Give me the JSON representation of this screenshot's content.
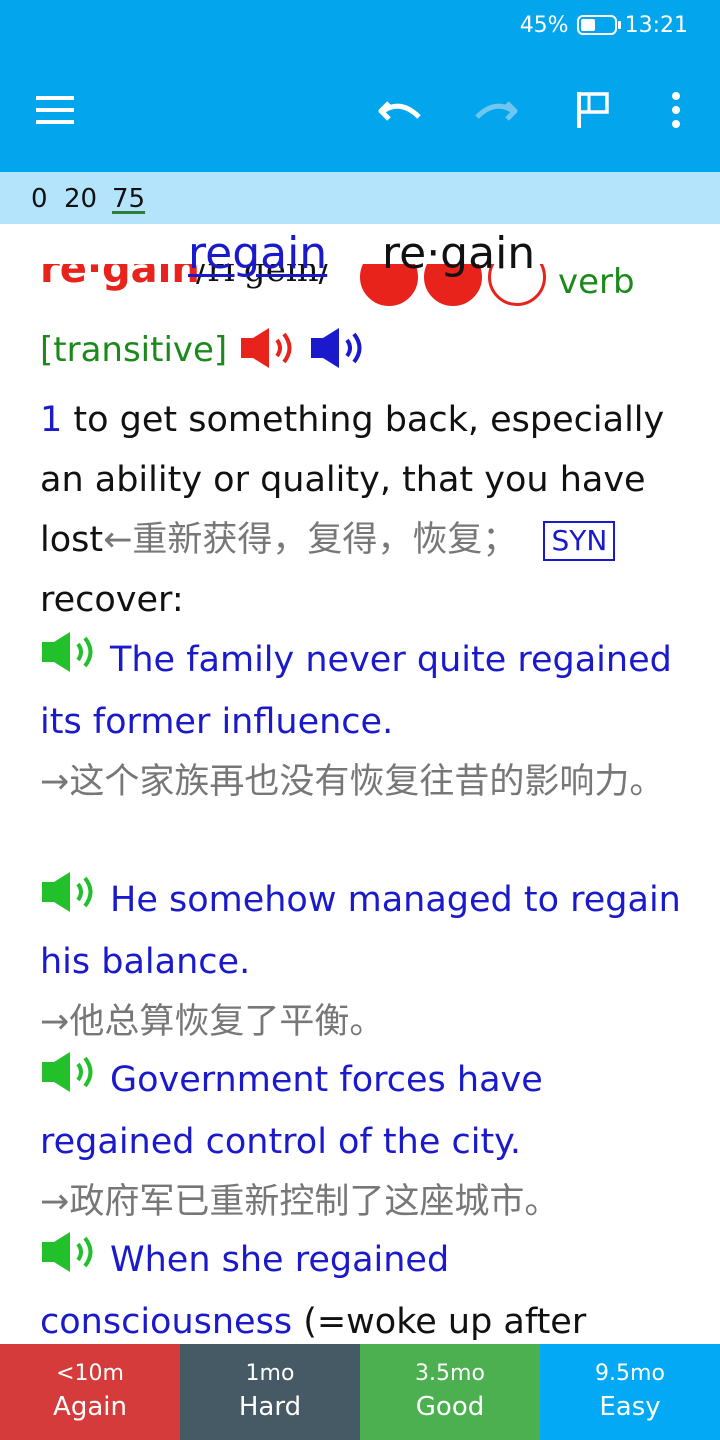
{
  "status_bar": {
    "battery": "45%",
    "time": "13:21",
    "battery_level": 0.45
  },
  "toolbar": {
    "icons": [
      "menu-icon",
      "undo-icon",
      "redo-icon",
      "flag-icon",
      "more-vert-icon"
    ]
  },
  "counts": {
    "new": "0",
    "learning": "20",
    "review": "75"
  },
  "question": {
    "word": "regain",
    "headword": "re·gain"
  },
  "entry": {
    "headword": "re·gain",
    "phonetic": "/rɪˈɡeɪn/",
    "frequency_dots_filled": 2,
    "frequency_dots_total": 3,
    "pos": "verb",
    "grammar": "[transitive]"
  },
  "definition": {
    "number": "1",
    "text": "to get something back, especially an ability or quality, that you have lost",
    "zh": "←重新获得，复得，恢复；",
    "syn_label": "SYN",
    "syn_word": " recover:"
  },
  "examples": [
    {
      "en": "The family never quite regained its former influence.",
      "zh": "→这个家族再也没有恢复往昔的影响力。"
    },
    {
      "en": "He somehow managed to regain his balance.",
      "zh": "→他总算恢复了平衡。"
    },
    {
      "en": "Government forces have regained control of the city.",
      "zh": "→政府军已重新控制了这座城市。"
    },
    {
      "en": "When she regained consciousness",
      "extra": " (=woke up after",
      "zh": ""
    }
  ],
  "answers": [
    {
      "interval": "<10m",
      "label": "Again"
    },
    {
      "interval": "1mo",
      "label": "Hard"
    },
    {
      "interval": "3.5mo",
      "label": "Good"
    },
    {
      "interval": "9.5mo",
      "label": "Easy"
    }
  ],
  "colors": {
    "toolbar": "#03a5ed",
    "counter_strip": "#b3e4fb",
    "again": "#d63b3b",
    "hard": "#455a64",
    "good": "#4caf50",
    "easy": "#03a9f4",
    "example_text": "#1a1acc",
    "headword_red": "#e8231c",
    "grammar_green": "#1b8a1b"
  }
}
